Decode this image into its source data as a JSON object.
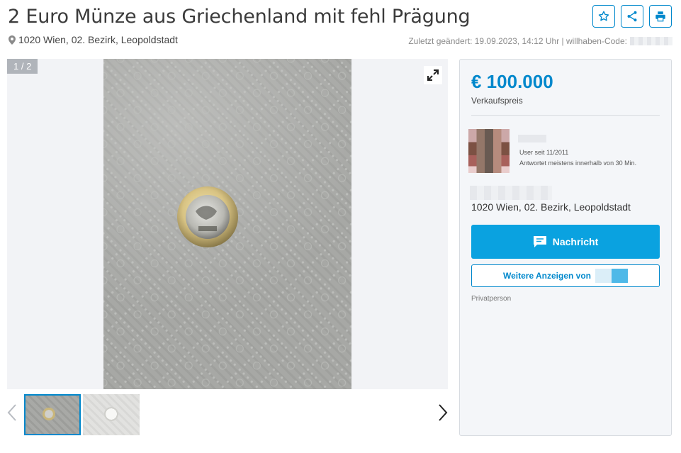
{
  "listing": {
    "title": "2 Euro Münze aus Griechenland mit fehl Prägung",
    "location": "1020 Wien, 02. Bezirk, Leopoldstadt",
    "meta_text": "Zuletzt geändert: 19.09.2023, 14:12 Uhr | willhaben-Code:"
  },
  "actions": {
    "icons": [
      "star-icon",
      "share-icon",
      "print-icon"
    ]
  },
  "gallery": {
    "counter": "1 / 2",
    "current_index": 1,
    "total": 2
  },
  "sidebar": {
    "price": "€ 100.000",
    "price_label": "Verkaufspreis",
    "user_since": "User seit 11/2011",
    "response_time": "Antwortet meistens innerhalb von 30 Min.",
    "address": "1020 Wien, 02. Bezirk, Leopoldstadt",
    "message_button": "Nachricht",
    "more_ads_button": "Weitere Anzeigen von",
    "seller_type": "Privatperson"
  },
  "colors": {
    "accent": "#0088cc",
    "button_blue": "#0aa2e0",
    "panel_bg": "#f4f6f9"
  }
}
